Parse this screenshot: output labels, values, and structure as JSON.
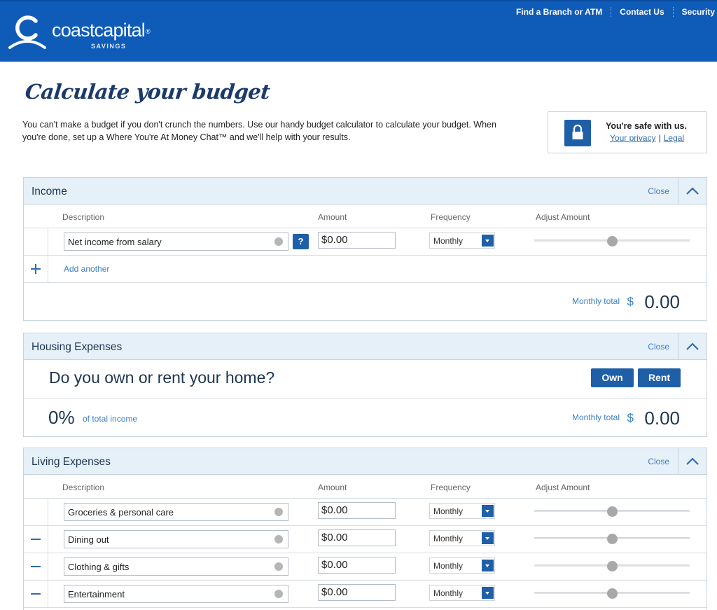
{
  "header": {
    "brand_name": "coastcapital",
    "brand_reg": "®",
    "brand_sub": "SAVINGS",
    "nav": [
      "Find a Branch or ATM",
      "Contact Us",
      "Security"
    ],
    "bg_color": "#0f5cb8"
  },
  "page": {
    "title": "Calculate your budget",
    "intro": "You can't make a budget if you don't crunch the numbers. Use our handy budget calculator to calculate your budget. When you're done, set up a Where You're At Money Chat™ and we'll help with your results."
  },
  "safe_box": {
    "title": "You're safe with us.",
    "privacy_link": "Your privacy",
    "separator": "|",
    "legal_link": "Legal",
    "icon": "lock-icon"
  },
  "columns": {
    "description": "Description",
    "amount": "Amount",
    "frequency": "Frequency",
    "adjust": "Adjust Amount"
  },
  "income": {
    "title": "Income",
    "close_label": "Close",
    "rows": [
      {
        "description": "Net income from salary",
        "amount": "$0.00",
        "frequency": "Monthly",
        "slider_fraction": 0.5
      }
    ],
    "help_label": "?",
    "add_label": "Add another",
    "total_label": "Monthly total",
    "currency": "$",
    "total_value": "0.00"
  },
  "housing": {
    "title": "Housing Expenses",
    "close_label": "Close",
    "question": "Do you own or rent your home?",
    "own_label": "Own",
    "rent_label": "Rent",
    "percent": "0%",
    "percent_label": "of total income",
    "total_label": "Monthly total",
    "currency": "$",
    "total_value": "0.00"
  },
  "living": {
    "title": "Living Expenses",
    "close_label": "Close",
    "rows": [
      {
        "description": "Groceries & personal care",
        "amount": "$0.00",
        "frequency": "Monthly",
        "slider_fraction": 0.5
      },
      {
        "description": "Dining out",
        "amount": "$0.00",
        "frequency": "Monthly",
        "slider_fraction": 0.5
      },
      {
        "description": "Clothing & gifts",
        "amount": "$0.00",
        "frequency": "Monthly",
        "slider_fraction": 0.5
      },
      {
        "description": "Entertainment",
        "amount": "$0.00",
        "frequency": "Monthly",
        "slider_fraction": 0.5
      }
    ]
  },
  "colors": {
    "accent": "#1f5fa8",
    "link": "#3d7ec0",
    "panel_header": "#e6f0f8"
  }
}
